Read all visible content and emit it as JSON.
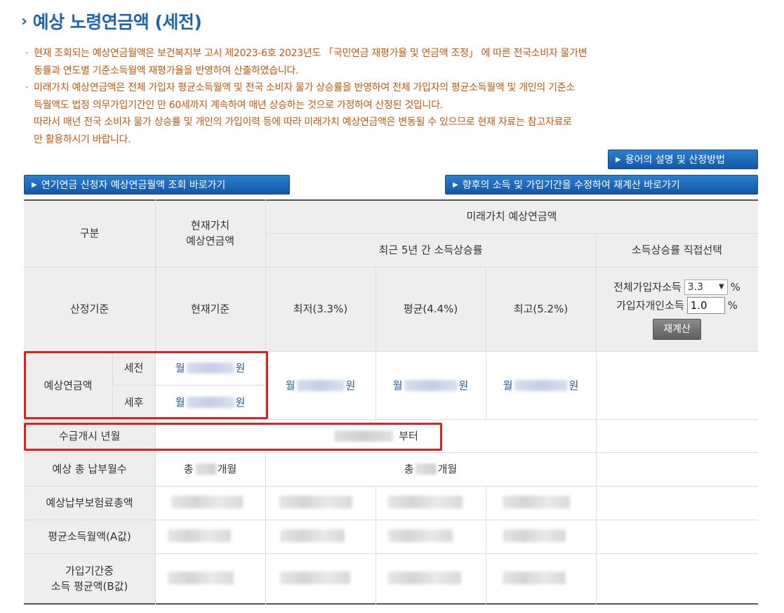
{
  "page": {
    "title": "예상 노령연금액 (세전)"
  },
  "notes": [
    {
      "lines": [
        "현재 조회되는 예상연금월액은 보건복지부 고시 제2023-6호 2023년도 「국민연금 재평가율 및 연금액 조정」 에 따른 전국소비자 물가변",
        "동률과 연도별 기준소득월액 재평가율을 반영하여 산출하였습니다."
      ]
    },
    {
      "lines": [
        "미래가치 예상연금액은 전체 가입자 평균소득월액 및 전국 소비자 물가 상승률을 반영하여 전체 가입자의 평균소득월액 및 개인의 기준소",
        "득월액도 법정 의무가입기간인 만 60세까지 계속하여 매년 상승하는 것으로 가정하여 산정된 것입니다.",
        "따라서 매년 전국 소비자 물가 상승률 및 개인의 가입이력 등에 따라 미래가치 예상연금액은 변동될 수 있으므로 현재 자료는 참고자료로",
        "만 활용하시기 바랍니다."
      ]
    }
  ],
  "buttons": {
    "terms": "용어의 설명 및 산정방법",
    "pension": "연기연금 신청자 예상연금월액 조회 바로가기",
    "recalc_link": "향후의 소득 및 가입기간을 수정하여 재계산 바로가기"
  },
  "table": {
    "h_category": "구분",
    "h_current": [
      "현재가치",
      "예상연금액"
    ],
    "h_future": "미래가치 예상연금액",
    "h_recent5": "최근 5년 간 소득상승률",
    "h_direct": "소득상승률 직접선택",
    "basis_label": "산정기준",
    "basis_current": "현재기준",
    "basis_low": "최저(3.3%)",
    "basis_avg": "평균(4.4%)",
    "basis_high": "최고(5.2%)",
    "ctrl_all_label": "전체가입자소득",
    "ctrl_all_value": "3.3",
    "ctrl_ind_label": "가입자개인소득",
    "ctrl_ind_value": "1.0",
    "pct": "%",
    "recalc_btn": "재계산",
    "expected_label": "예상연금액",
    "pretax": "세전",
    "aftertax": "세후",
    "month": "월",
    "won": "원",
    "start_label": "수급개시 년월",
    "start_suffix": "부터",
    "months_label": "예상 총 납부월수",
    "total": "총",
    "months_unit": "개월",
    "premium_label": "예상납부보험료총액",
    "avg_income_label": "평균소득월액(A값)",
    "b_label_1": "가입기간중",
    "b_label_2": "소득 평균액(B값)"
  },
  "colors": {
    "title": "#1f66b0",
    "note": "#c8580a",
    "highlight": "#e0201e",
    "header_bg": "#eeeeee"
  }
}
